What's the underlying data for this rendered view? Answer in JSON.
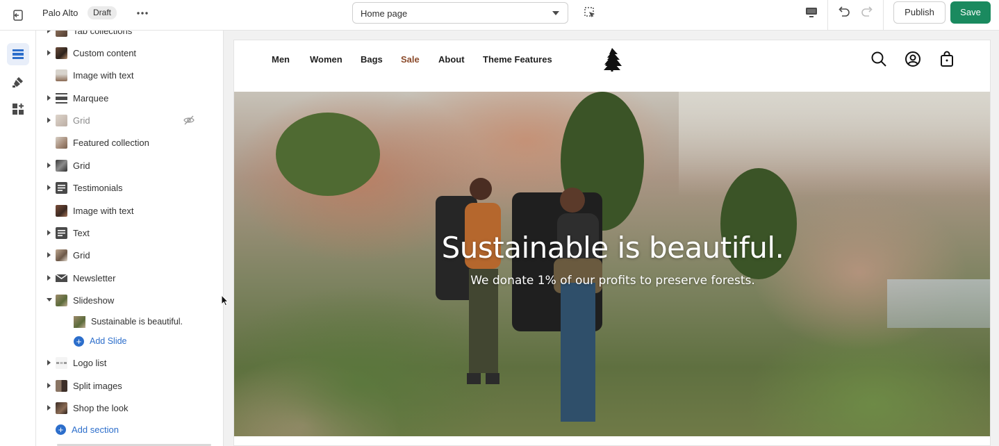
{
  "topbar": {
    "store_name": "Palo Alto",
    "status_badge": "Draft",
    "page_selector": "Home page",
    "publish_label": "Publish",
    "save_label": "Save"
  },
  "rail": {
    "items": [
      {
        "icon": "sections-icon",
        "active": true
      },
      {
        "icon": "theme-settings-icon",
        "active": false
      },
      {
        "icon": "app-embeds-icon",
        "active": false
      }
    ]
  },
  "sidebar": {
    "sections": [
      {
        "label": "Tab collections"
      },
      {
        "label": "Custom content"
      },
      {
        "label": "Image with text"
      },
      {
        "label": "Marquee"
      },
      {
        "label": "Grid"
      },
      {
        "label": "Featured collection"
      },
      {
        "label": "Grid"
      },
      {
        "label": "Testimonials"
      },
      {
        "label": "Image with text"
      },
      {
        "label": "Text"
      },
      {
        "label": "Grid"
      },
      {
        "label": "Newsletter"
      },
      {
        "label": "Slideshow"
      },
      {
        "label": "Logo list"
      },
      {
        "label": "Split images"
      },
      {
        "label": "Shop the look"
      }
    ],
    "slideshow_child": "Sustainable is beautiful.",
    "add_slide": "Add Slide",
    "add_section": "Add section"
  },
  "preview": {
    "nav": [
      "Men",
      "Women",
      "Bags",
      "Sale",
      "About",
      "Theme Features"
    ],
    "hero_title": "Sustainable is beautiful.",
    "hero_subtitle": "We donate 1% of our profits to preserve forests."
  },
  "colors": {
    "save": "#1a8a5f",
    "link": "#2c6ecb",
    "sale": "#8b4b2b",
    "rail_active": "#e8eef9"
  }
}
